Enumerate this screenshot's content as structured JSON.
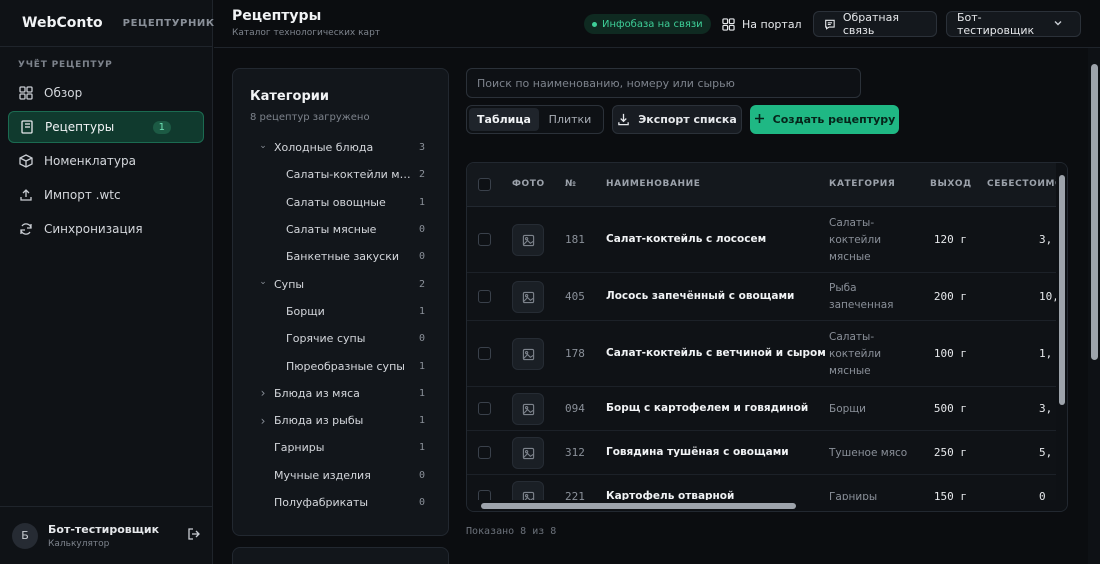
{
  "brand": {
    "name": "WebConto",
    "section": "РЕЦЕПТУРНИК"
  },
  "sidebar": {
    "section_label": "УЧЁТ РЕЦЕПТУР",
    "items": [
      {
        "label": "Обзор",
        "icon": "grid-icon"
      },
      {
        "label": "Рецептуры",
        "icon": "book-icon",
        "badge": "1",
        "active": true
      },
      {
        "label": "Номенклатура",
        "icon": "box-icon"
      },
      {
        "label": "Импорт .wtc",
        "icon": "upload-icon"
      },
      {
        "label": "Синхронизация",
        "icon": "sync-icon"
      }
    ],
    "user": {
      "initial": "Б",
      "name": "Бот-тестировщик",
      "role": "Калькулятор"
    }
  },
  "header": {
    "title": "Рецептуры",
    "subtitle": "Каталог технологических карт",
    "status": "Инфобаза на связи",
    "portal_label": "На портал",
    "feedback_label": "Обратная связь",
    "user_menu_label": "Бот-тестировщик"
  },
  "categories": {
    "title": "Категории",
    "count_text": "8 рецептур загружено",
    "items": [
      {
        "label": "Холодные блюда",
        "count": "3",
        "level": 0,
        "chevron": "down"
      },
      {
        "label": "Салаты-коктейли мяс...",
        "count": "2",
        "level": 1
      },
      {
        "label": "Салаты овощные",
        "count": "1",
        "level": 1
      },
      {
        "label": "Салаты мясные",
        "count": "0",
        "level": 1
      },
      {
        "label": "Банкетные закуски",
        "count": "0",
        "level": 1
      },
      {
        "label": "Супы",
        "count": "2",
        "level": 0,
        "chevron": "down"
      },
      {
        "label": "Борщи",
        "count": "1",
        "level": 1
      },
      {
        "label": "Горячие супы",
        "count": "0",
        "level": 1
      },
      {
        "label": "Пюреобразные супы",
        "count": "1",
        "level": 1
      },
      {
        "label": "Блюда из мяса",
        "count": "1",
        "level": 0,
        "chevron": "right"
      },
      {
        "label": "Блюда из рыбы",
        "count": "1",
        "level": 0,
        "chevron": "right"
      },
      {
        "label": "Гарниры",
        "count": "1",
        "level": 0
      },
      {
        "label": "Мучные изделия",
        "count": "0",
        "level": 0
      },
      {
        "label": "Полуфабрикаты",
        "count": "0",
        "level": 0
      }
    ]
  },
  "toolbar": {
    "search_placeholder": "Поиск по наименованию, номеру или сырью",
    "view_table": "Таблица",
    "view_tiles": "Плитки",
    "export_label": "Экспорт списка",
    "create_label": "Создать рецептуру"
  },
  "table": {
    "headers": {
      "photo": "ФОТО",
      "num": "№",
      "name": "НАИМЕНОВАНИЕ",
      "category": "КАТЕГОРИЯ",
      "output": "ВЫХОД",
      "cost": "СЕБЕСТОИМОСТЬ"
    },
    "rows": [
      {
        "num": "181",
        "name": "Салат-коктейль с лососем",
        "category": "Салаты-коктейли мясные",
        "output": "120 г",
        "cost": "3,"
      },
      {
        "num": "405",
        "name": "Лосось запечённый с овощами",
        "category": "Рыба запеченная",
        "output": "200 г",
        "cost": "10,"
      },
      {
        "num": "178",
        "name": "Салат-коктейль с ветчиной и сыром",
        "category": "Салаты-коктейли мясные",
        "output": "100 г",
        "cost": "1,"
      },
      {
        "num": "094",
        "name": "Борщ с картофелем и говядиной",
        "category": "Борщи",
        "output": "500 г",
        "cost": "3,"
      },
      {
        "num": "312",
        "name": "Говядина тушёная с овощами",
        "category": "Тушеное мясо",
        "output": "250 г",
        "cost": "5,"
      },
      {
        "num": "221",
        "name": "Картофель отварной",
        "category": "Гарниры",
        "output": "150 г",
        "cost": "0"
      }
    ],
    "footer": "Показано 8 из 8"
  },
  "colors": {
    "accent": "#1fb884",
    "background": "#0b0d10",
    "panel": "#12161b"
  }
}
